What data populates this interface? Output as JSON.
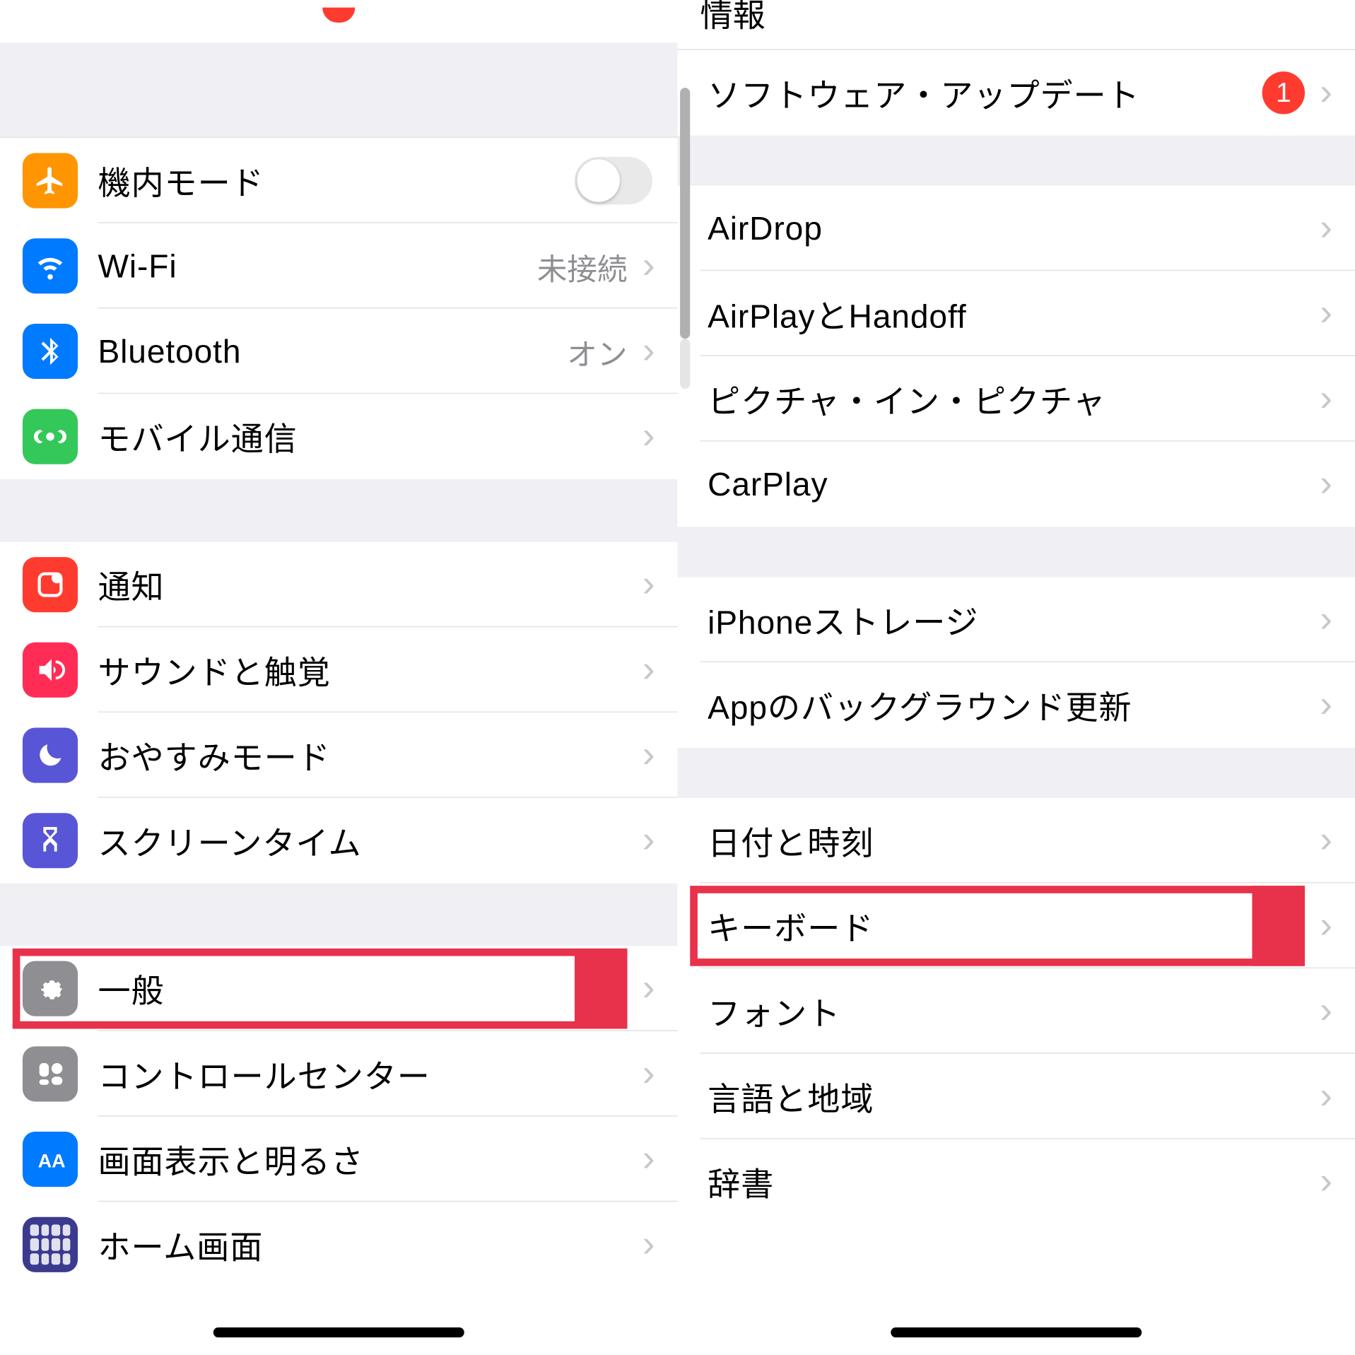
{
  "left": {
    "airplane": "機内モード",
    "wifi": "Wi-Fi",
    "wifi_detail": "未接続",
    "bluetooth": "Bluetooth",
    "bluetooth_detail": "オン",
    "cellular": "モバイル通信",
    "notifications": "通知",
    "sounds": "サウンドと触覚",
    "dnd": "おやすみモード",
    "screentime": "スクリーンタイム",
    "general": "一般",
    "controlcenter": "コントロールセンター",
    "display": "画面表示と明るさ",
    "homescreen": "ホーム画面"
  },
  "right": {
    "info_partial": "情報",
    "software_update": "ソフトウェア・アップデート",
    "software_update_badge": "1",
    "airdrop": "AirDrop",
    "airplay": "AirPlayとHandoff",
    "pip": "ピクチャ・イン・ピクチャ",
    "carplay": "CarPlay",
    "storage": "iPhoneストレージ",
    "background": "Appのバックグラウンド更新",
    "datetime": "日付と時刻",
    "keyboard": "キーボード",
    "font": "フォント",
    "language": "言語と地域",
    "dictionary": "辞書"
  }
}
